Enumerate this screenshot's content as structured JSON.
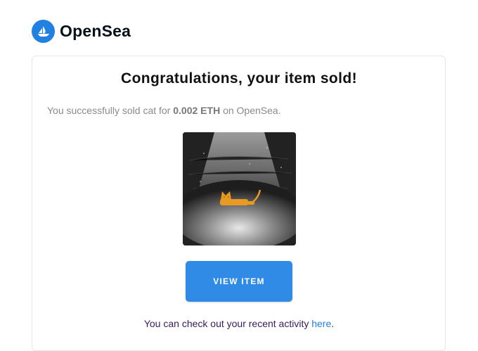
{
  "brand": {
    "name": "OpenSea",
    "accent": "#2081e2"
  },
  "email": {
    "title": "Congratulations, your item sold!",
    "message_prefix": "You successfully sold cat for ",
    "price": "0.002 ETH",
    "message_suffix": " on OpenSea.",
    "item_image": {
      "icon": "cat-nft-image"
    },
    "button_label": "VIEW ITEM",
    "activity_prefix": "You can check out your recent activity ",
    "activity_link": "here",
    "activity_suffix": "."
  }
}
